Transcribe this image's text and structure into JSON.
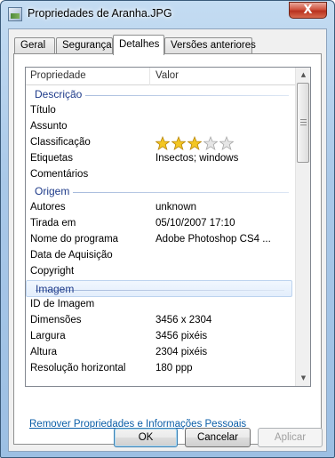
{
  "window": {
    "title": "Propriedades de Aranha.JPG",
    "close_glyph": "X"
  },
  "tabs": [
    {
      "label": "Geral"
    },
    {
      "label": "Segurança"
    },
    {
      "label": "Detalhes"
    },
    {
      "label": "Versões anteriores"
    }
  ],
  "active_tab": "Detalhes",
  "grid": {
    "header": {
      "property": "Propriedade",
      "value": "Valor"
    },
    "groups": [
      {
        "name": "Descrição",
        "rows": [
          {
            "key": "Título",
            "value": ""
          },
          {
            "key": "Assunto",
            "value": ""
          },
          {
            "key": "Classificação",
            "rating": 3,
            "rating_max": 5
          },
          {
            "key": "Etiquetas",
            "value": "Insectos; windows"
          },
          {
            "key": "Comentários",
            "value": ""
          }
        ]
      },
      {
        "name": "Origem",
        "rows": [
          {
            "key": "Autores",
            "value": "unknown"
          },
          {
            "key": "Tirada em",
            "value": "05/10/2007 17:10"
          },
          {
            "key": "Nome do programa",
            "value": "Adobe Photoshop CS4 ..."
          },
          {
            "key": "Data de Aquisição",
            "value": ""
          },
          {
            "key": "Copyright",
            "value": ""
          }
        ]
      },
      {
        "name": "Imagem",
        "highlighted": true,
        "rows": [
          {
            "key": "ID de Imagem",
            "value": ""
          },
          {
            "key": "Dimensões",
            "value": "3456 x 2304"
          },
          {
            "key": "Largura",
            "value": "3456 pixéis"
          },
          {
            "key": "Altura",
            "value": "2304 pixéis"
          },
          {
            "key": "Resolução horizontal",
            "value": "180 ppp"
          }
        ]
      }
    ]
  },
  "link": {
    "label": "Remover Propriedades e Informações Pessoais"
  },
  "buttons": {
    "ok": "OK",
    "cancel": "Cancelar",
    "apply": "Aplicar"
  },
  "colors": {
    "star_filled": "#f3c623",
    "star_empty": "#e6e6e6",
    "group_text": "#1e3b8a",
    "link": "#0b5ea8"
  },
  "icons": {
    "app": "jpg-image-icon",
    "close": "close-icon",
    "star": "star-icon"
  }
}
